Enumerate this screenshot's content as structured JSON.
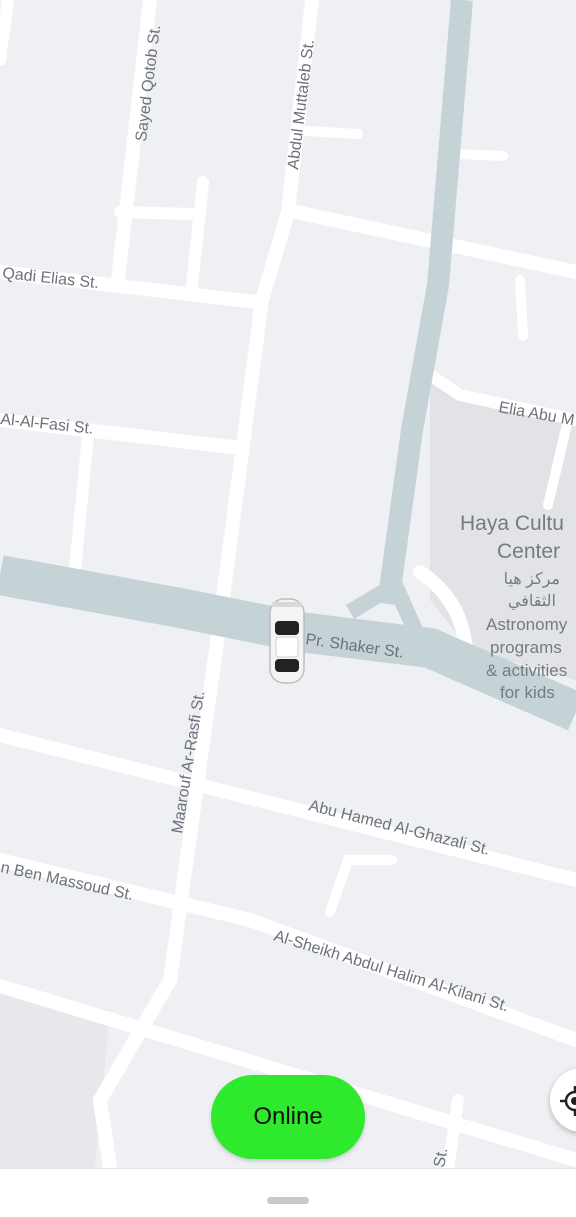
{
  "map": {
    "streets": {
      "sayed_qotob": "Sayed Qotob St.",
      "abdul_muttaleb": "Abdul Muttaleb St.",
      "qadi_elias": "Qadi Elias St.",
      "al_fasi": "Al-Al-Fasi St.",
      "elia_abu": "Elia Abu M",
      "pr_shaker": "Pr. Shaker St.",
      "maarouf": "Maarouf Ar-Rasfi St.",
      "abu_hamed": "Abu Hamed Al-Ghazali St.",
      "ben_massoud": "n Ben Massoud St.",
      "al_sheikh": "Al-Sheikh Abdul Halim Al-Kilani St.",
      "st_bottom": "St."
    },
    "poi": {
      "name_line1": "Haya Cultu",
      "name_line2": "Center",
      "arabic_line1": "مركز هيا",
      "arabic_line2": "الثقافي",
      "desc_line1": "Astronomy",
      "desc_line2": "programs",
      "desc_line3": "& activities",
      "desc_line4": "for kids"
    },
    "icons": {
      "vehicle": "car-icon",
      "locate": "my-location-icon"
    }
  },
  "controls": {
    "online_label": "Online",
    "online_color": "#2fea2c"
  }
}
